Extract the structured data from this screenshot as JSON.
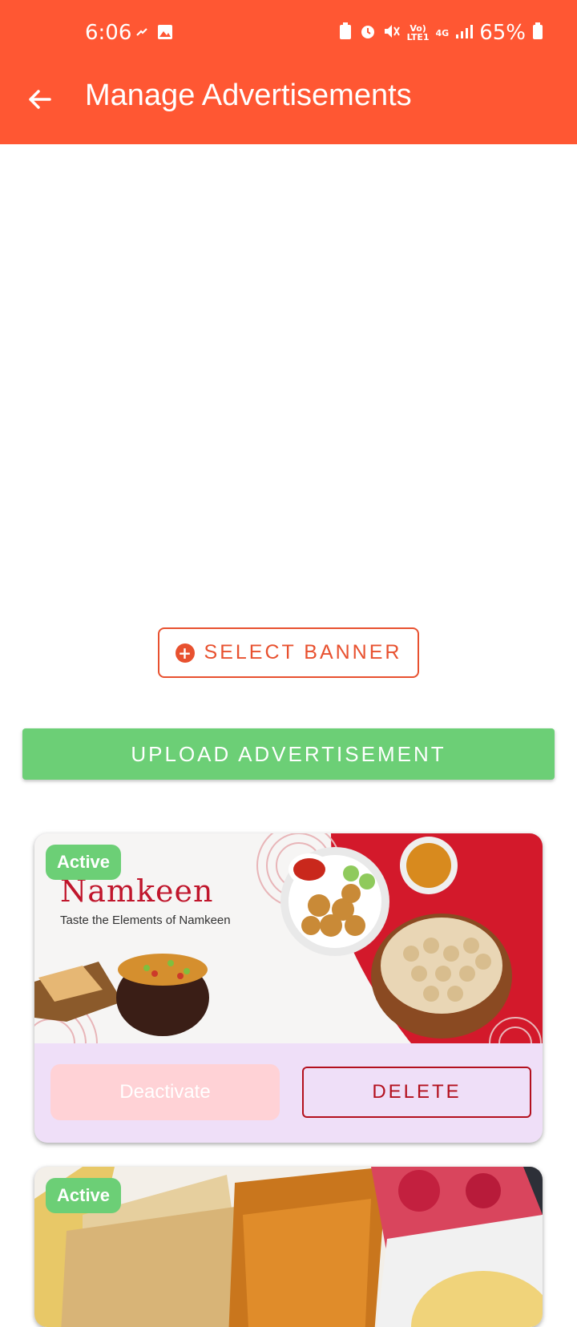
{
  "status_bar": {
    "time": "6:06",
    "battery": "65%",
    "net_label_top": "Vo)",
    "net_label_bottom": "LTE1",
    "net_gen": "4G"
  },
  "app_bar": {
    "title": "Manage Advertisements",
    "back_icon": "arrow-left-icon",
    "color": "#ff5733"
  },
  "actions": {
    "select_banner_label": "SELECT BANNER",
    "upload_label": "UPLOAD ADVERTISEMENT"
  },
  "ads": [
    {
      "status": "Active",
      "brand": "Namkeen",
      "tagline": "Taste the Elements of Namkeen",
      "deactivate_label": "Deactivate",
      "delete_label": "DELETE"
    },
    {
      "status": "Active"
    }
  ],
  "colors": {
    "accent": "#e8512f",
    "success": "#6ccf76",
    "danger": "#b3101e",
    "card_bg": "#efdff8"
  }
}
